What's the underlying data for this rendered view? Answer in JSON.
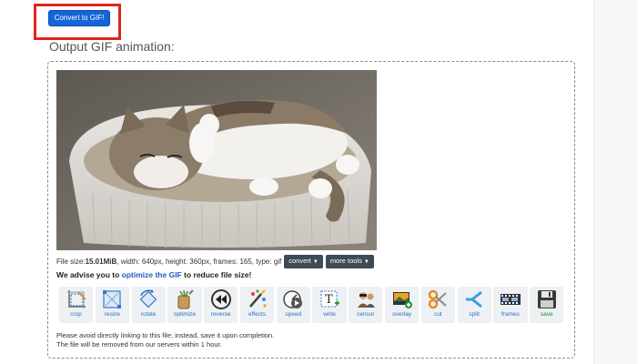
{
  "convert_button": {
    "label": "Convert to GIF!"
  },
  "heading": "Output GIF animation:",
  "file_info": {
    "prefix": "File size: ",
    "size": "15.01MiB",
    "details": ", width: 640px, height: 360px, frames: 165, type: gif"
  },
  "dropdowns": {
    "convert": "convert",
    "more_tools": "more tools"
  },
  "advise": {
    "before": "We advise you to ",
    "link": "optimize the GIF",
    "after": " to reduce file size!"
  },
  "tools": [
    {
      "label": "crop",
      "icon": "crop-icon"
    },
    {
      "label": "resize",
      "icon": "resize-icon"
    },
    {
      "label": "rotate",
      "icon": "rotate-icon"
    },
    {
      "label": "optimize",
      "icon": "optimize-icon"
    },
    {
      "label": "reverse",
      "icon": "reverse-icon"
    },
    {
      "label": "effects",
      "icon": "effects-icon"
    },
    {
      "label": "speed",
      "icon": "speed-icon"
    },
    {
      "label": "write",
      "icon": "write-icon"
    },
    {
      "label": "censor",
      "icon": "censor-icon"
    },
    {
      "label": "overlay",
      "icon": "overlay-icon"
    },
    {
      "label": "cut",
      "icon": "cut-icon"
    },
    {
      "label": "split",
      "icon": "split-icon"
    },
    {
      "label": "frames",
      "icon": "frames-icon"
    },
    {
      "label": "save",
      "icon": "save-icon"
    }
  ],
  "note": {
    "line1": "Please avoid directly linking to this file; instead, save it upon completion.",
    "line2": "The file will be removed from our servers within 1 hour."
  },
  "colors": {
    "accent": "#1565d8",
    "highlight": "#e0241c",
    "link": "#1f5fbf"
  }
}
